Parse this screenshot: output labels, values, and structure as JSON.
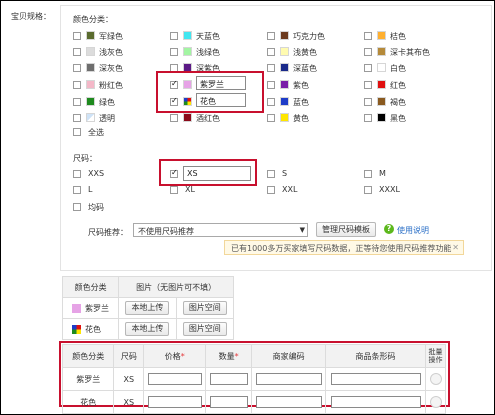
{
  "side_label": "宝贝规格：",
  "color_section": {
    "title": "颜色分类：",
    "items": [
      {
        "label": "军绿色",
        "swatch": "#5a6b2e",
        "checked": false
      },
      {
        "label": "天蓝色",
        "swatch": "#41e6f0",
        "checked": false
      },
      {
        "label": "巧克力色",
        "swatch": "#6b3a1e",
        "checked": false
      },
      {
        "label": "桔色",
        "swatch": "#ffb030",
        "checked": false
      },
      {
        "label": "浅灰色",
        "swatch": "#dcdcdc",
        "checked": false
      },
      {
        "label": "浅绿色",
        "swatch": "#a3f5a3",
        "checked": false
      },
      {
        "label": "浅黄色",
        "swatch": "#fffbb0",
        "checked": false
      },
      {
        "label": "深卡其布色",
        "swatch": "#b58a3a",
        "checked": false
      },
      {
        "label": "深灰色",
        "swatch": "#6e6e6e",
        "checked": false
      },
      {
        "label": "深紫色",
        "swatch": "#5b1a86",
        "checked": false
      },
      {
        "label": "深蓝色",
        "swatch": "#1a2a8a",
        "checked": false
      },
      {
        "label": "白色",
        "swatch": "#ffffff",
        "checked": false
      },
      {
        "label": "粉红色",
        "swatch": "#f4b8c8",
        "checked": false
      },
      {
        "label": "紫罗兰",
        "swatch": "#e6a3e6",
        "checked": true
      },
      {
        "label": "紫色",
        "swatch": "#7a1ea8",
        "checked": false
      },
      {
        "label": "红色",
        "swatch": "#e01010",
        "checked": false
      },
      {
        "label": "绿色",
        "swatch": "#1e8a1e",
        "checked": false
      },
      {
        "label": "花色",
        "swatch": "multicolor",
        "checked": true
      },
      {
        "label": "蓝色",
        "swatch": "#1e3cc8",
        "checked": false
      },
      {
        "label": "褐色",
        "swatch": "#8a5a20",
        "checked": false
      },
      {
        "label": "透明",
        "swatch": "transparent",
        "checked": false
      },
      {
        "label": "酒红色",
        "swatch": "#8a0a1a",
        "checked": false
      },
      {
        "label": "黄色",
        "swatch": "#ffe600",
        "checked": false
      },
      {
        "label": "黑色",
        "swatch": "#000000",
        "checked": false
      }
    ],
    "select_all": "全选"
  },
  "size_section": {
    "title": "尺码：",
    "items": [
      {
        "label": "XXS",
        "checked": false
      },
      {
        "label": "XS",
        "checked": true
      },
      {
        "label": "S",
        "checked": false
      },
      {
        "label": "M",
        "checked": false
      },
      {
        "label": "L",
        "checked": false
      },
      {
        "label": "XL",
        "checked": false
      },
      {
        "label": "XXL",
        "checked": false
      },
      {
        "label": "XXXL",
        "checked": false
      },
      {
        "label": "均码",
        "checked": false
      }
    ],
    "recommend_label": "尺码推荐：",
    "recommend_select": "不使用尺码推荐",
    "manage_button": "管理尺码模板",
    "help_link": "使用说明",
    "notice": "已有1000多万买家填写尺码数据，正等待您使用尺码推荐功能"
  },
  "image_table": {
    "headers": [
      "颜色分类",
      "图片（无图片可不填）"
    ],
    "rows": [
      {
        "color": "紫罗兰",
        "swatch": "#e6a3e6",
        "upload": "本地上传",
        "space": "图片空间"
      },
      {
        "color": "花色",
        "swatch": "multicolor",
        "upload": "本地上传",
        "space": "图片空间"
      }
    ]
  },
  "sku_table": {
    "headers": [
      "颜色分类",
      "尺码",
      "价格",
      "数量",
      "商家编码",
      "商品条形码",
      "批量操作"
    ],
    "required_mark": "*",
    "rows": [
      {
        "color": "紫罗兰",
        "size": "XS"
      },
      {
        "color": "花色",
        "size": "XS"
      }
    ]
  },
  "colors": {
    "highlight": "#c8102e",
    "link": "#2a6fc7",
    "required": "#e4393c"
  }
}
